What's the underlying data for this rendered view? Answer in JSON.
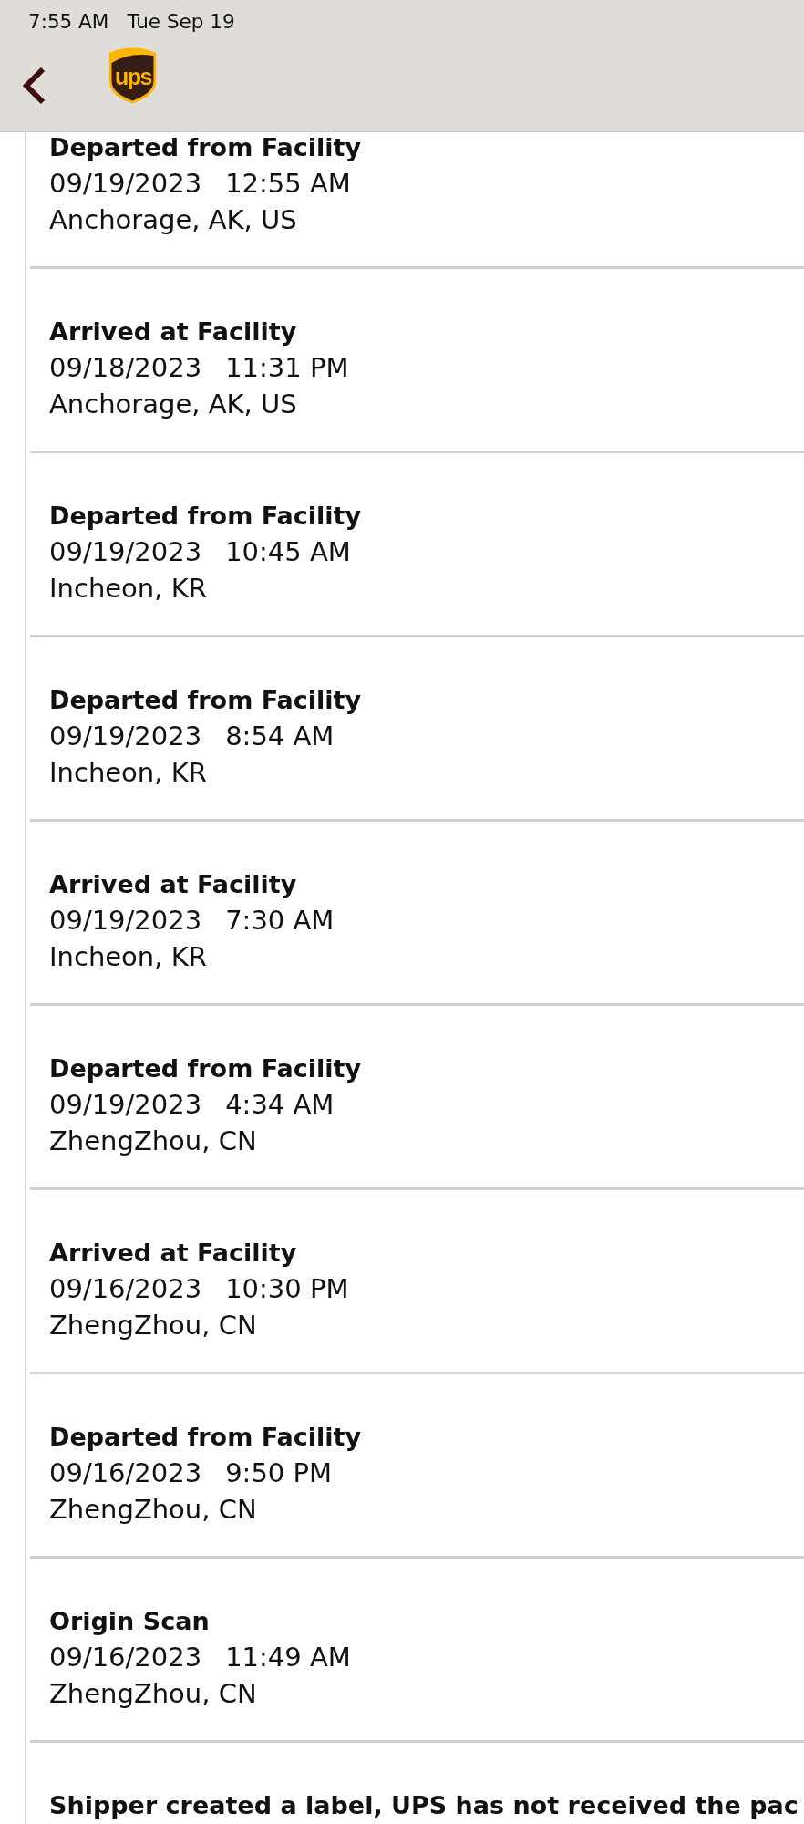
{
  "status_bar": {
    "time": "7:55 AM",
    "date": "Tue Sep 19"
  },
  "nav_bar": {
    "logo_text": "ups"
  },
  "events": [
    {
      "status": "Departed from Facility",
      "date": "09/19/2023",
      "time": "12:55 AM",
      "location": "Anchorage, AK, US"
    },
    {
      "status": "Arrived at Facility",
      "date": "09/18/2023",
      "time": "11:31 PM",
      "location": "Anchorage, AK, US"
    },
    {
      "status": "Departed from Facility",
      "date": "09/19/2023",
      "time": "10:45 AM",
      "location": "Incheon, KR"
    },
    {
      "status": "Departed from Facility",
      "date": "09/19/2023",
      "time": "8:54 AM",
      "location": "Incheon, KR"
    },
    {
      "status": "Arrived at Facility",
      "date": "09/19/2023",
      "time": "7:30 AM",
      "location": "Incheon, KR"
    },
    {
      "status": "Departed from Facility",
      "date": "09/19/2023",
      "time": "4:34 AM",
      "location": "ZhengZhou, CN"
    },
    {
      "status": "Arrived at Facility",
      "date": "09/16/2023",
      "time": "10:30 PM",
      "location": "ZhengZhou, CN"
    },
    {
      "status": "Departed from Facility",
      "date": "09/16/2023",
      "time": "9:50 PM",
      "location": "ZhengZhou, CN"
    },
    {
      "status": "Origin Scan",
      "date": "09/16/2023",
      "time": "11:49 AM",
      "location": "ZhengZhou, CN"
    },
    {
      "status": "Shipper created a label, UPS has not received the pac"
    }
  ]
}
